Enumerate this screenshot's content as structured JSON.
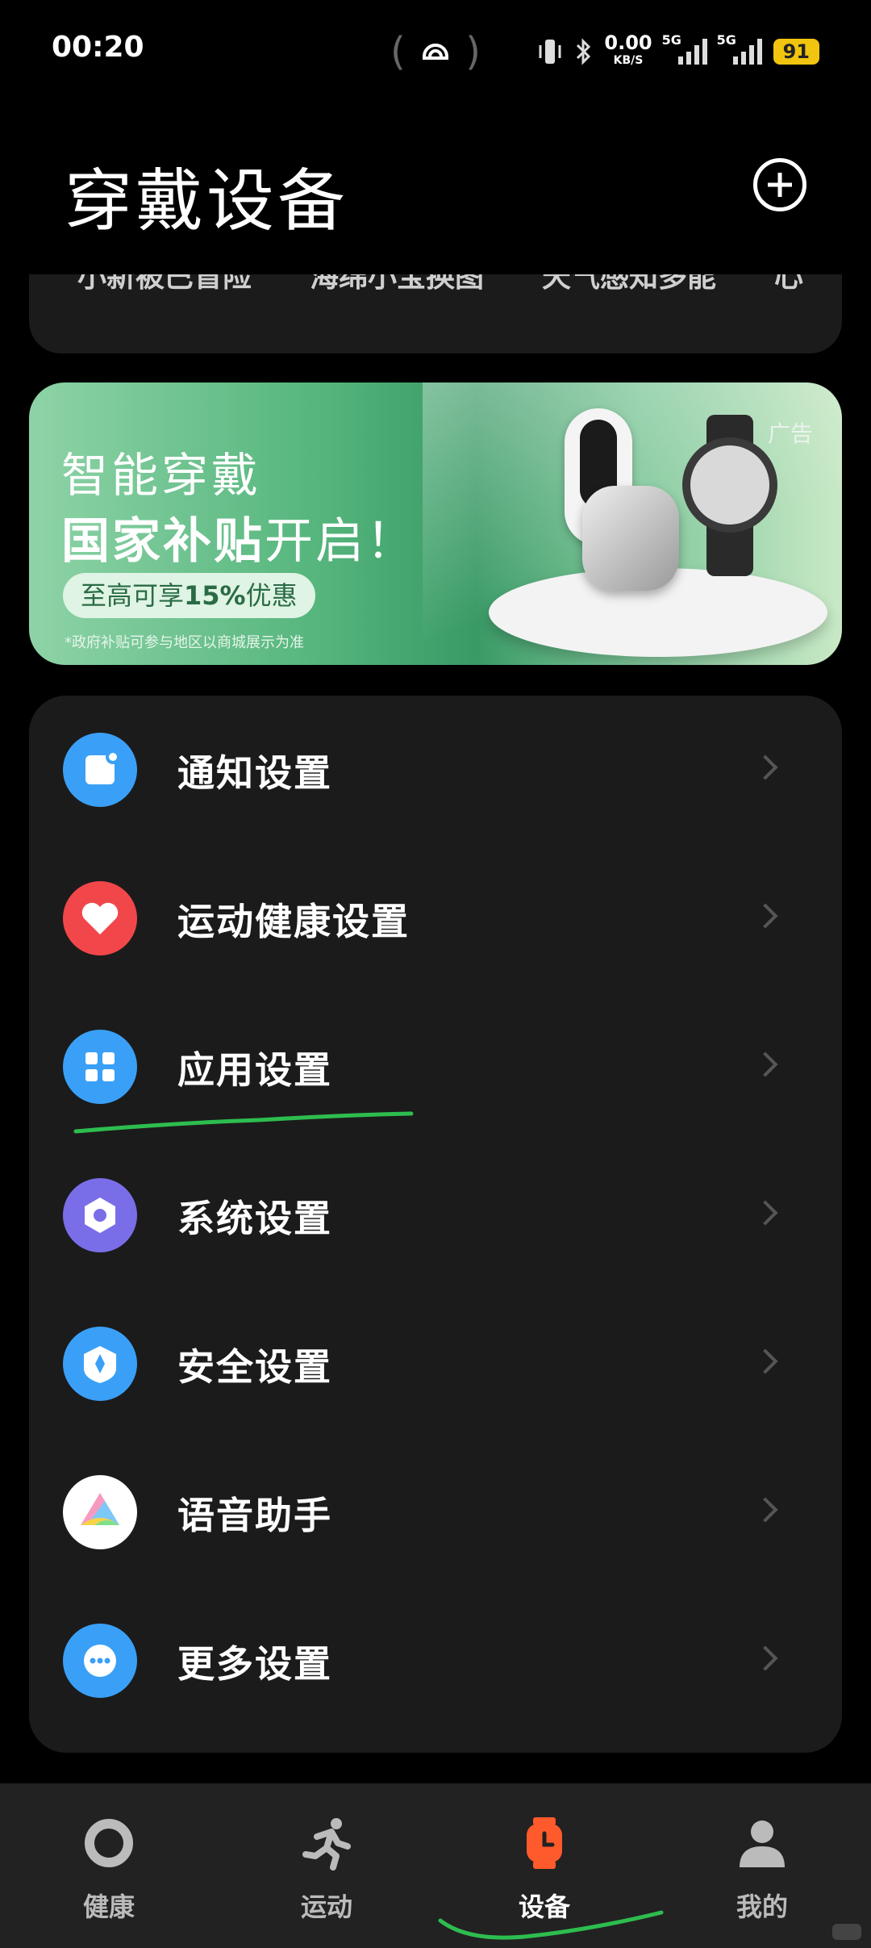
{
  "status_bar": {
    "time": "00:20",
    "net_speed": "0.00",
    "net_unit": "KB/S",
    "sim1": "5G",
    "sim2": "5G",
    "battery": "91"
  },
  "header": {
    "title": "穿戴设备",
    "add_icon": "plus-circle-icon"
  },
  "feature_strip": {
    "items": [
      "小新被巴盲险",
      "海绵小宝换图",
      "天气感知多能",
      "心"
    ]
  },
  "banner": {
    "line1": "智能穿戴",
    "line2_bold": "国家补贴",
    "line2_rest": "开启！",
    "pill_prefix": "至高可享",
    "pill_bold": "15%",
    "pill_suffix": "优惠",
    "note": "*政府补贴可参与地区以商城展示为准",
    "ad_label": "广告"
  },
  "settings": {
    "items": [
      {
        "label": "通知设置",
        "icon": "notification-icon",
        "color": "#3aa0f7"
      },
      {
        "label": "运动健康设置",
        "icon": "heart-icon",
        "color": "#f2474a"
      },
      {
        "label": "应用设置",
        "icon": "apps-grid-icon",
        "color": "#3aa0f7"
      },
      {
        "label": "系统设置",
        "icon": "hexagon-settings-icon",
        "color": "#7a6ee8"
      },
      {
        "label": "安全设置",
        "icon": "shield-icon",
        "color": "#3aa0f7"
      },
      {
        "label": "语音助手",
        "icon": "voice-assistant-icon",
        "color": "#ffffff"
      },
      {
        "label": "更多设置",
        "icon": "more-dots-icon",
        "color": "#3aa0f7"
      }
    ]
  },
  "bottom_nav": {
    "tabs": [
      {
        "label": "健康",
        "icon": "ring-icon"
      },
      {
        "label": "运动",
        "icon": "running-icon"
      },
      {
        "label": "设备",
        "icon": "watch-icon",
        "active": true
      },
      {
        "label": "我的",
        "icon": "person-icon"
      }
    ]
  },
  "colors": {
    "accent_active": "#ff5a2c",
    "annotation": "#2dbd4f"
  }
}
